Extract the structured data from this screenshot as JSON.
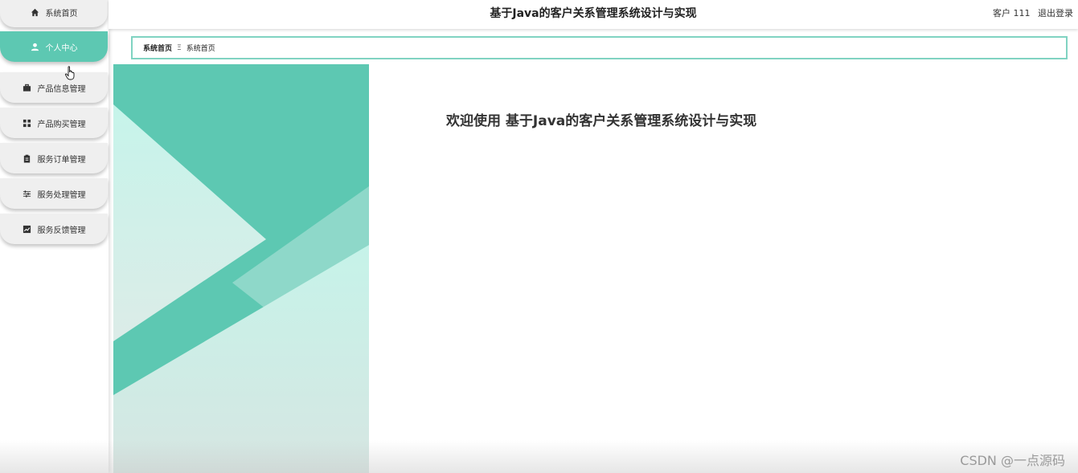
{
  "header": {
    "title": "基于Java的客户关系管理系统设计与实现",
    "user_label": "客户 111",
    "logout_label": "退出登录"
  },
  "sidebar": {
    "items": [
      {
        "label": "系统首页",
        "icon": "home-icon",
        "active": false
      },
      {
        "label": "个人中心",
        "icon": "user-icon",
        "active": true
      },
      {
        "label": "产品信息管理",
        "icon": "briefcase-icon",
        "active": false
      },
      {
        "label": "产品购买管理",
        "icon": "grid-icon",
        "active": false
      },
      {
        "label": "服务订单管理",
        "icon": "clipboard-icon",
        "active": false
      },
      {
        "label": "服务处理管理",
        "icon": "sliders-icon",
        "active": false
      },
      {
        "label": "服务反馈管理",
        "icon": "chart-icon",
        "active": false
      }
    ]
  },
  "breadcrumb": {
    "items": [
      "系统首页",
      "系统首页"
    ],
    "separator": "Ξ"
  },
  "main": {
    "welcome_text": "欢迎使用 基于Java的客户关系管理系统设计与实现"
  },
  "watermark": "CSDN @一点源码",
  "colors": {
    "accent": "#5dc8b2",
    "accent_light": "#c9f3ea",
    "sidebar_item_bg": "#efefef"
  }
}
